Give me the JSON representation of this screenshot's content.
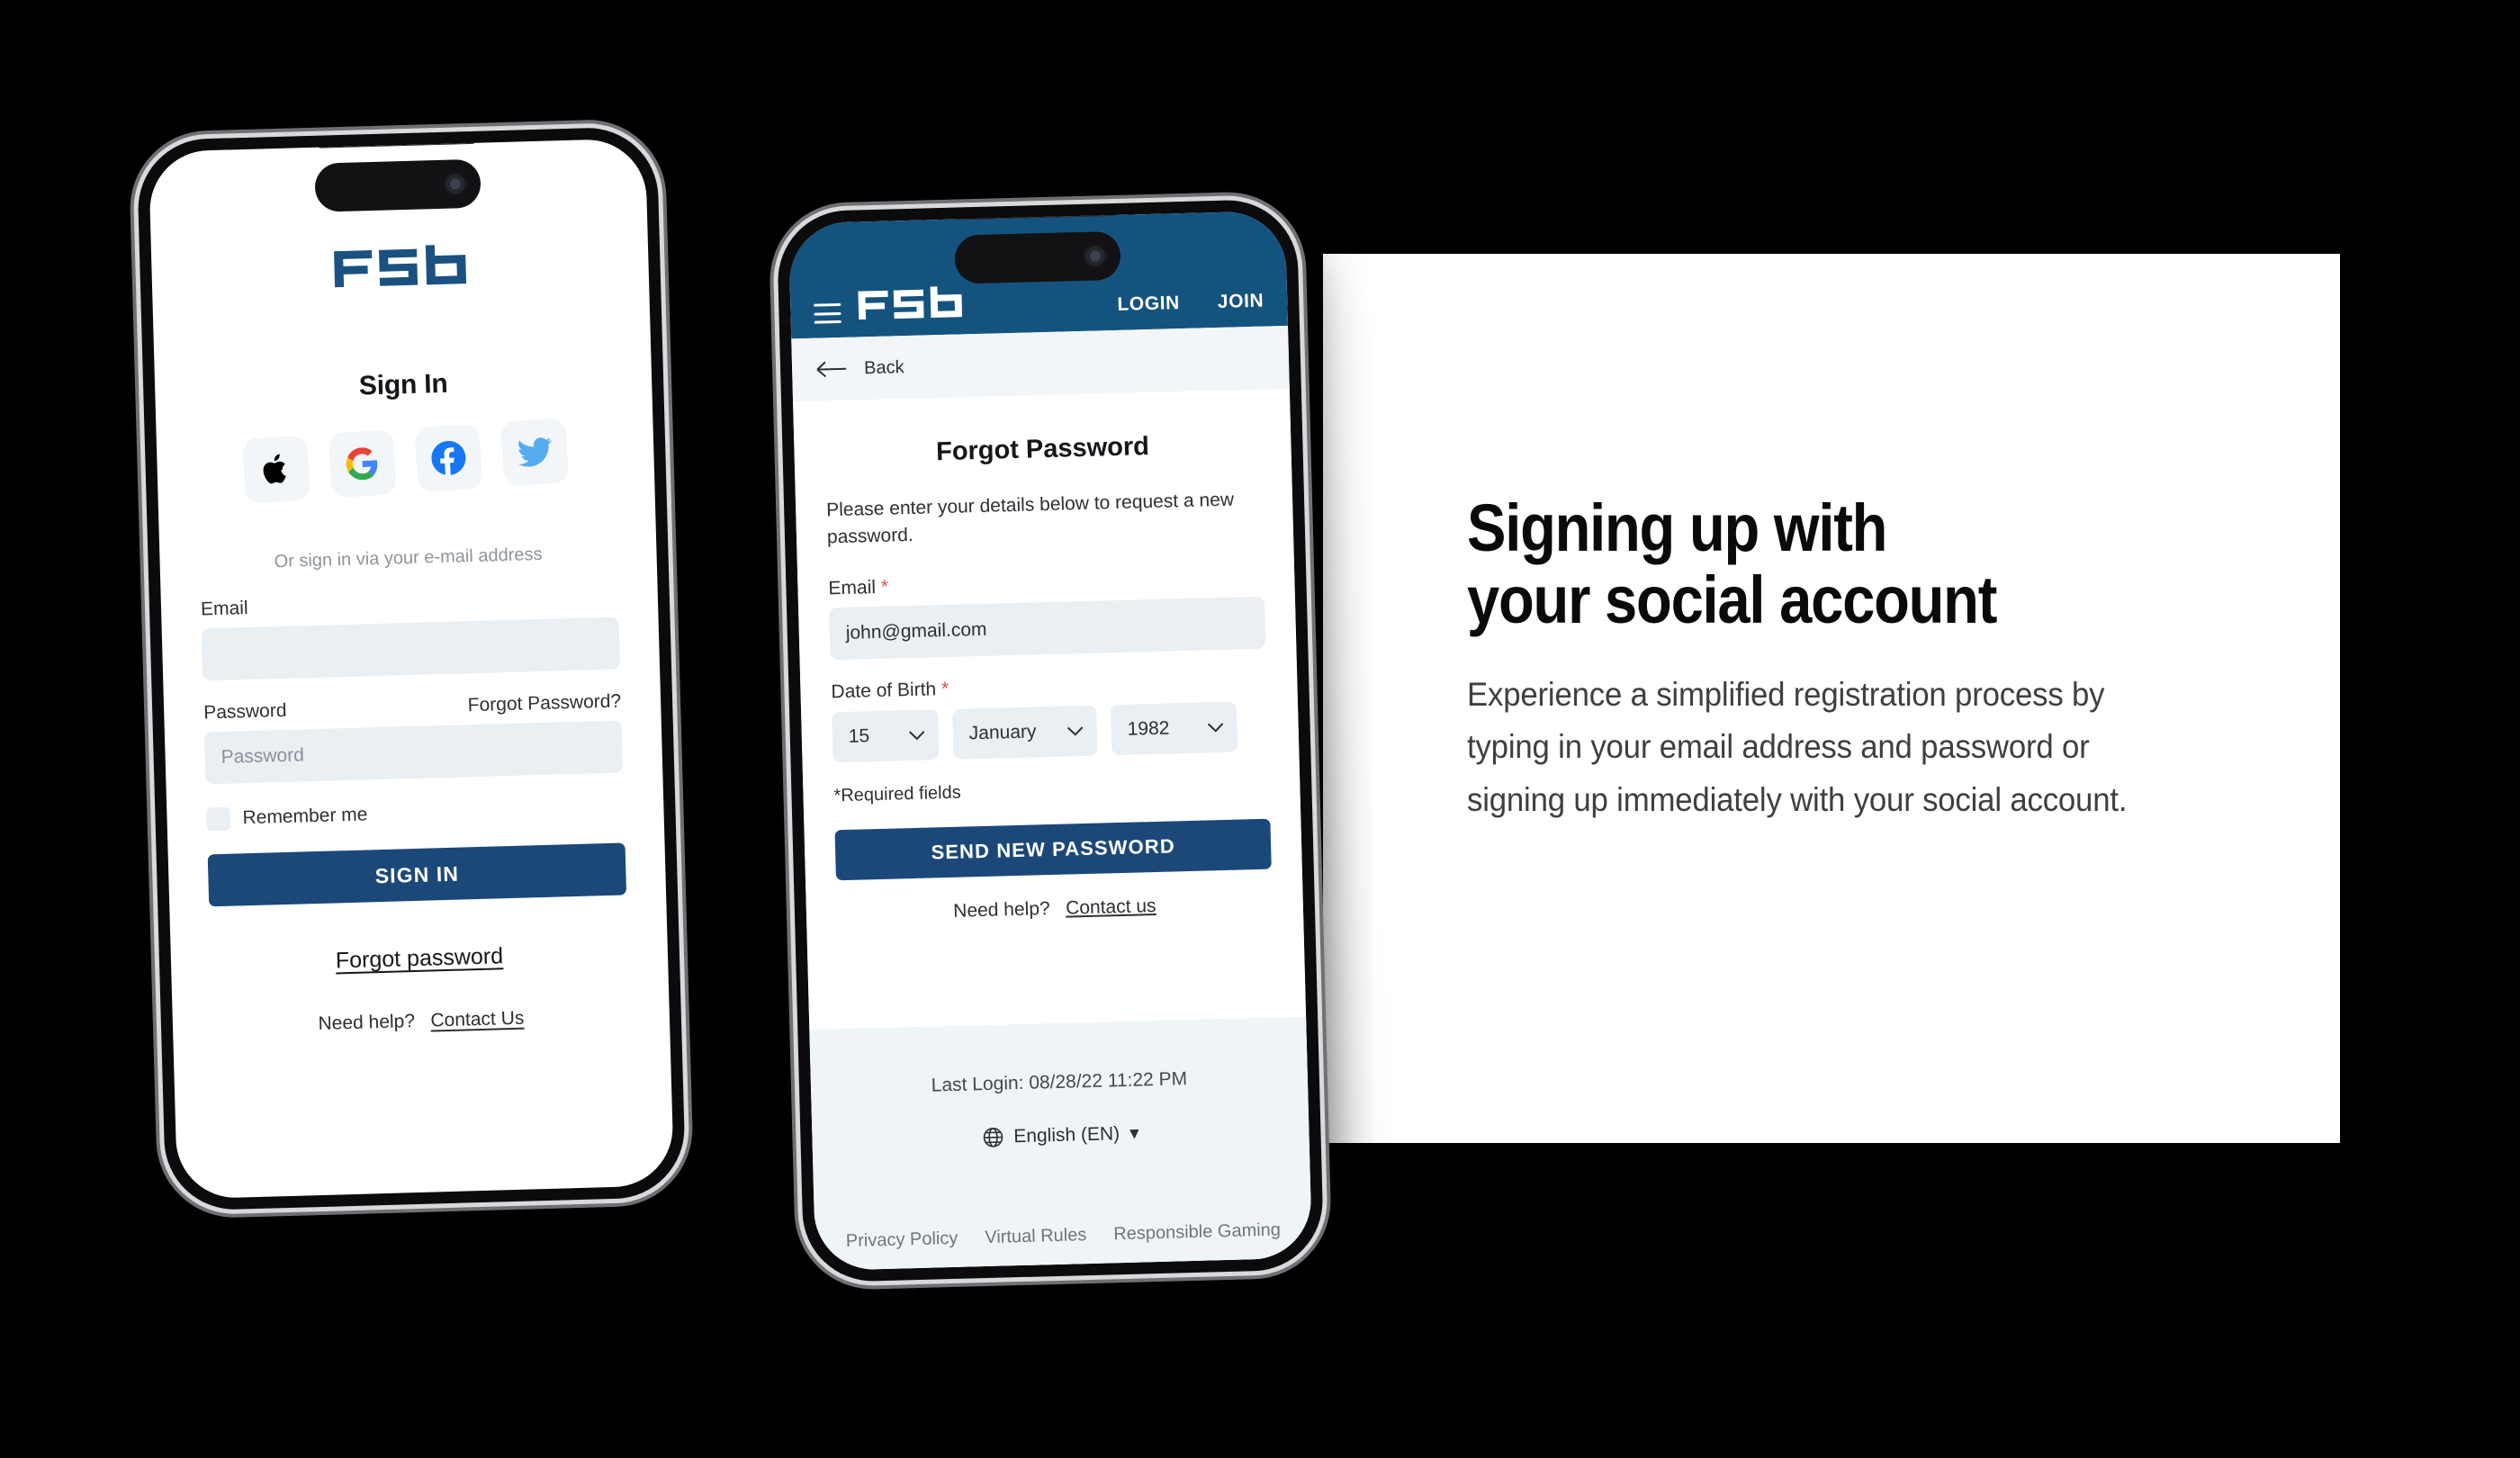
{
  "brand": {
    "name": "FSB",
    "primary_blue": "#15537F",
    "button_blue": "#1B4878",
    "field_grey": "#EAEFF4"
  },
  "info_panel": {
    "title": "Signing up with\nyour social account",
    "body": "Experience a simplified registration process by typing in your email address and password or signing up immediately with your social account."
  },
  "phone_signin": {
    "logo": "FSB",
    "heading": "Sign In",
    "social_providers": [
      {
        "name": "Apple",
        "icon": "apple-icon"
      },
      {
        "name": "Google",
        "icon": "google-icon"
      },
      {
        "name": "Facebook",
        "icon": "facebook-icon"
      },
      {
        "name": "Twitter",
        "icon": "twitter-icon"
      }
    ],
    "divider_text": "Or sign in via your e-mail address",
    "email": {
      "label": "Email",
      "value": "",
      "placeholder": ""
    },
    "password": {
      "label": "Password",
      "forgot_link": "Forgot Password?",
      "placeholder": "Password",
      "value": "",
      "toggle_icon": "eye-icon"
    },
    "remember_me": {
      "label": "Remember me",
      "checked": false
    },
    "submit_label": "SIGN IN",
    "forgot_password_link": "Forgot password",
    "help_prefix": "Need help?",
    "help_link": "Contact Us"
  },
  "phone_forgot": {
    "header": {
      "menu_icon": "hamburger-icon",
      "logo": "FSB",
      "login_label": "LOGIN",
      "join_label": "JOIN"
    },
    "back": {
      "icon": "arrow-left-icon",
      "label": "Back"
    },
    "title": "Forgot Password",
    "description": "Please enter your details below to request a new password.",
    "email": {
      "label": "Email",
      "required": "*",
      "value": "john@gmail.com"
    },
    "dob": {
      "label": "Date of Birth",
      "required": "*",
      "day": "15",
      "month": "January",
      "year": "1982"
    },
    "required_note": "*Required fields",
    "submit_label": "SEND NEW PASSWORD",
    "help_prefix": "Need help?",
    "help_link": "Contact us",
    "last_login": "Last Login: 08/28/22 11:22 PM",
    "language": {
      "icon": "globe-icon",
      "label": "English (EN)",
      "caret": "▾"
    },
    "footer_links": [
      "Privacy Policy",
      "Virtual Rules",
      "Responsible Gaming"
    ]
  }
}
